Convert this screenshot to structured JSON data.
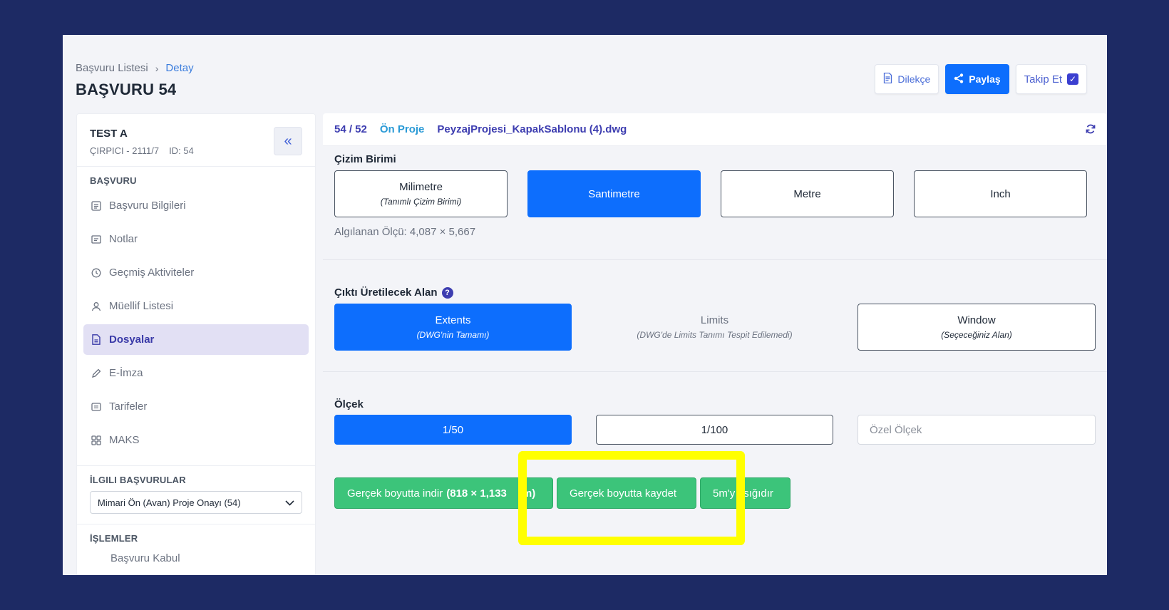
{
  "header": {
    "breadcrumb": [
      "Başvuru Listesi",
      "Detay"
    ],
    "title": "BAŞVURU 54",
    "actions": {
      "petition": "Dilekçe",
      "share": "Paylaş",
      "follow": "Takip Et"
    }
  },
  "sidebar": {
    "name": "TEST A",
    "sub": {
      "place": "ÇIRPICI - 2111/7",
      "id": "ID: 54"
    },
    "section_title": "BAŞVURU",
    "items": [
      {
        "label": "Başvuru Bilgileri",
        "icon": "document-icon"
      },
      {
        "label": "Notlar",
        "icon": "note-icon"
      },
      {
        "label": "Geçmiş Aktiviteler",
        "icon": "clock-icon"
      },
      {
        "label": "Müellif Listesi",
        "icon": "user-icon"
      },
      {
        "label": "Dosyalar",
        "icon": "file-icon"
      },
      {
        "label": "E-İmza",
        "icon": "pen-icon"
      },
      {
        "label": "Tarifeler",
        "icon": "list-icon"
      },
      {
        "label": "MAKS",
        "icon": "grid-icon"
      }
    ],
    "related_title": "İLGILI BAŞVURULAR",
    "related_value": "Mimari Ön (Avan) Proje Onayı (54)",
    "ops_title": "İŞLEMLER",
    "ops_first": "Başvuru Kabul"
  },
  "main": {
    "file": {
      "count": "54 / 52",
      "stage": "Ön Proje",
      "name": "PeyzajProjesi_KapakSablonu (4).dwg"
    },
    "unit_label": "Çizim Birimi",
    "units": [
      {
        "label": "Milimetre",
        "sub": "(Tanımlı Çizim Birimi)"
      },
      {
        "label": "Santimetre"
      },
      {
        "label": "Metre"
      },
      {
        "label": "Inch"
      }
    ],
    "detected": "Algılanan Ölçü: 4,087 × 5,667",
    "area_label": "Çıktı Üretilecek Alan",
    "areas": [
      {
        "label": "Extents",
        "sub": "(DWG'nin Tamamı)"
      },
      {
        "label": "Limits",
        "sub": "(DWG'de Limits Tanımı Tespit Edilemedi)"
      },
      {
        "label": "Window",
        "sub": "(Seçeceğiniz Alan)"
      }
    ],
    "scale_label": "Ölçek",
    "scales": [
      "1/50",
      "1/100"
    ],
    "custom_placeholder": "Özel Ölçek",
    "actions": {
      "download": "Gerçek boyutta indir",
      "download_size": "(818 × 1,133",
      "download_tail": "m)",
      "save": "Gerçek boyutta kaydet",
      "fit_a": "5m'y",
      "fit_b": "sığıdır"
    }
  },
  "colors": {
    "primary": "#0d6efd",
    "success": "#3cc47a",
    "highlight": "#ffff00",
    "frame": "#1d2a64"
  }
}
